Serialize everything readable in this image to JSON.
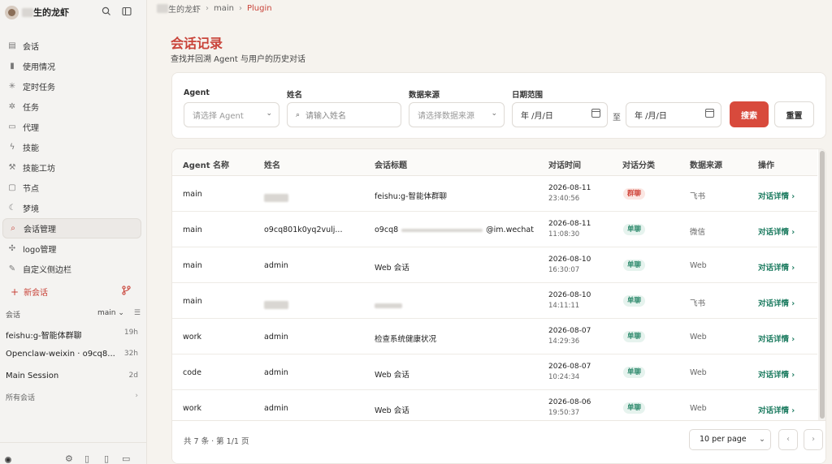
{
  "app": {
    "name": "生的龙虾"
  },
  "breadcrumb": {
    "workspace": "生的龙虾",
    "branch": "main",
    "current": "Plugin"
  },
  "sidebar": {
    "items": [
      {
        "icon": "document-icon",
        "label": "会话"
      },
      {
        "icon": "bar-chart-icon",
        "label": "使用情况"
      },
      {
        "icon": "loader-icon",
        "label": "定时任务"
      },
      {
        "icon": "sparkle-icon",
        "label": "任务"
      },
      {
        "icon": "briefcase-icon",
        "label": "代理"
      },
      {
        "icon": "zap-icon",
        "label": "技能"
      },
      {
        "icon": "wrench-icon",
        "label": "技能工坊"
      },
      {
        "icon": "monitor-icon",
        "label": "节点"
      },
      {
        "icon": "moon-icon",
        "label": "梦境"
      },
      {
        "icon": "search-icon",
        "label": "会话管理",
        "active": true
      },
      {
        "icon": "puzzle-icon",
        "label": "logo管理"
      },
      {
        "icon": "pencil-icon",
        "label": "自定义侧边栏"
      }
    ],
    "new_chat_label": "新会话",
    "sessions_label": "会话",
    "sessions_filter_value": "main",
    "sessions": [
      {
        "title": "feishu:g-智能体群聊",
        "age": "19h"
      },
      {
        "title": "Openclaw-weixin · o9cq8...",
        "age": "32h"
      },
      {
        "title": "Main Session",
        "age": "2d"
      }
    ],
    "all_sessions_label": "所有会话"
  },
  "page": {
    "title": "会话记录",
    "subtitle": "查找并回溯 Agent 与用户的历史对话"
  },
  "filters": {
    "agent": {
      "label": "Agent",
      "placeholder": "请选择 Agent"
    },
    "name": {
      "label": "姓名",
      "placeholder": "请输入姓名"
    },
    "source": {
      "label": "数据来源",
      "placeholder": "请选择数据来源"
    },
    "date": {
      "label": "日期范围",
      "start_placeholder": "年 /月/日",
      "to_label": "至",
      "end_placeholder": "年 /月/日"
    },
    "search_label": "搜索",
    "reset_label": "重置"
  },
  "table": {
    "columns": [
      "Agent 名称",
      "姓名",
      "会话标题",
      "对话时间",
      "对话分类",
      "数据来源",
      "操作"
    ],
    "rows": [
      {
        "agent": "main",
        "name": "",
        "title": "feishu:g-智能体群聊",
        "date": "2026-08-11",
        "time": "23:40:56",
        "category": "群聊",
        "category_type": "group",
        "source": "飞书",
        "action": "对话详情 ›"
      },
      {
        "agent": "main",
        "name": "o9cq801k0yq2vulj...",
        "title": "o9cq8",
        "title_suffix": "@im.wechat",
        "date": "2026-08-11",
        "time": "11:08:30",
        "category": "单聊",
        "category_type": "single",
        "source": "微信",
        "action": "对话详情 ›"
      },
      {
        "agent": "main",
        "name": "admin",
        "title": "Web 会话",
        "date": "2026-08-10",
        "time": "16:30:07",
        "category": "单聊",
        "category_type": "single",
        "source": "Web",
        "action": "对话详情 ›"
      },
      {
        "agent": "main",
        "name": "",
        "title": "",
        "date": "2026-08-10",
        "time": "14:11:11",
        "category": "单聊",
        "category_type": "single",
        "source": "飞书",
        "action": "对话详情 ›"
      },
      {
        "agent": "work",
        "name": "admin",
        "title": "检查系统健康状况",
        "date": "2026-08-07",
        "time": "14:29:36",
        "category": "单聊",
        "category_type": "single",
        "source": "Web",
        "action": "对话详情 ›"
      },
      {
        "agent": "code",
        "name": "admin",
        "title": "Web 会话",
        "date": "2026-08-07",
        "time": "10:24:34",
        "category": "单聊",
        "category_type": "single",
        "source": "Web",
        "action": "对话详情 ›"
      },
      {
        "agent": "work",
        "name": "admin",
        "title": "Web 会话",
        "date": "2026-08-06",
        "time": "19:50:37",
        "category": "单聊",
        "category_type": "single",
        "source": "Web",
        "action": "对话详情 ›"
      }
    ]
  },
  "pagination": {
    "info": "共 7 条 · 第 1/1 页",
    "per_page": "10 per page",
    "prev": "‹",
    "next": "›"
  },
  "colors": {
    "accent": "#c9443a",
    "link": "#1f7d62"
  }
}
